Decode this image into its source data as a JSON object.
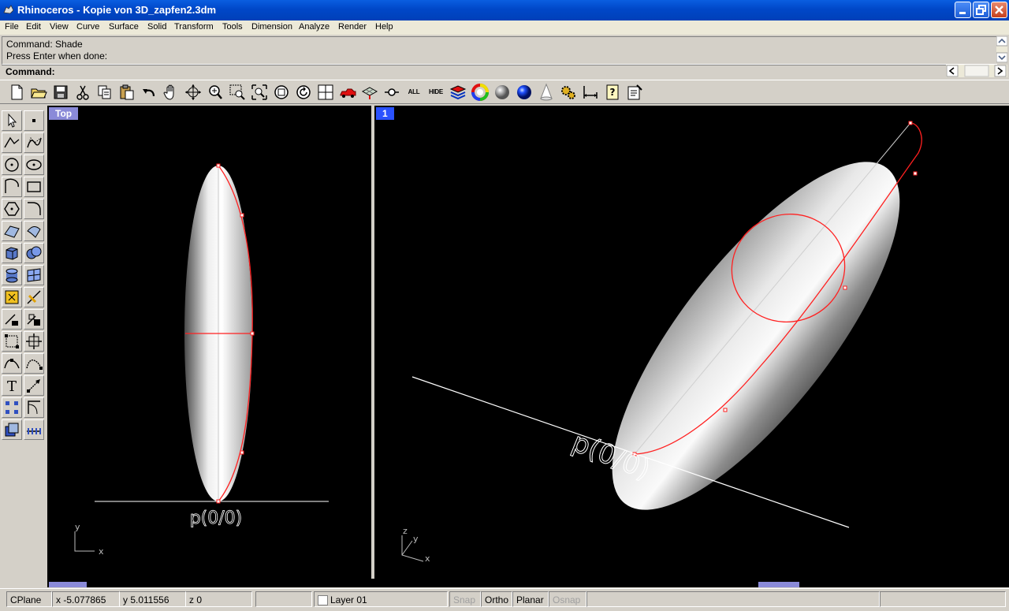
{
  "window": {
    "title": "Rhinoceros - Kopie von 3D_zapfen2.3dm"
  },
  "menu": [
    "File",
    "Edit",
    "View",
    "Curve",
    "Surface",
    "Solid",
    "Transform",
    "Tools",
    "Dimension",
    "Analyze",
    "Render",
    "Help"
  ],
  "command": {
    "history": [
      "Command: Shade",
      "Press Enter when done:"
    ],
    "prompt": "Command:"
  },
  "toolbar": {
    "icons": [
      "new-icon",
      "open-icon",
      "save-icon",
      "cut-icon",
      "copy-icon",
      "paste-icon",
      "undo-icon",
      "pan-hand-icon",
      "rotate-view-icon",
      "zoom-dynamic-icon",
      "zoom-window-icon",
      "zoom-selected-icon",
      "zoom-extents-icon",
      "zoom-previous-icon",
      "four-viewports-icon",
      "car-icon",
      "grid-icon",
      "layer-icon",
      "show-all-icon",
      "hide-icon",
      "layers-stack-icon",
      "color-wheel-icon",
      "gray-sphere-icon",
      "blue-sphere-icon",
      "spotlight-icon",
      "settings-gear-icon",
      "dimension-icon",
      "help-icon",
      "properties-icon"
    ],
    "all_label": "ALL",
    "hide_label": "HIDE"
  },
  "viewports": {
    "left": {
      "title": "Top",
      "label_text": "p(0/0)",
      "axis_y": "y",
      "axis_x": "x",
      "title_color": "#8a8ad8"
    },
    "right": {
      "title": "1",
      "label_text": "p(0/0)",
      "axis_z": "z",
      "axis_y": "y",
      "axis_x": "x",
      "title_color": "#2a52ff"
    },
    "curve_color": "#ff2020"
  },
  "status": {
    "cplane": "CPlane",
    "x": "x -5.077865",
    "y": "y 5.011556",
    "z": "z 0",
    "layer": "Layer 01",
    "snap": "Snap",
    "ortho": "Ortho",
    "planar": "Planar",
    "osnap": "Osnap"
  }
}
